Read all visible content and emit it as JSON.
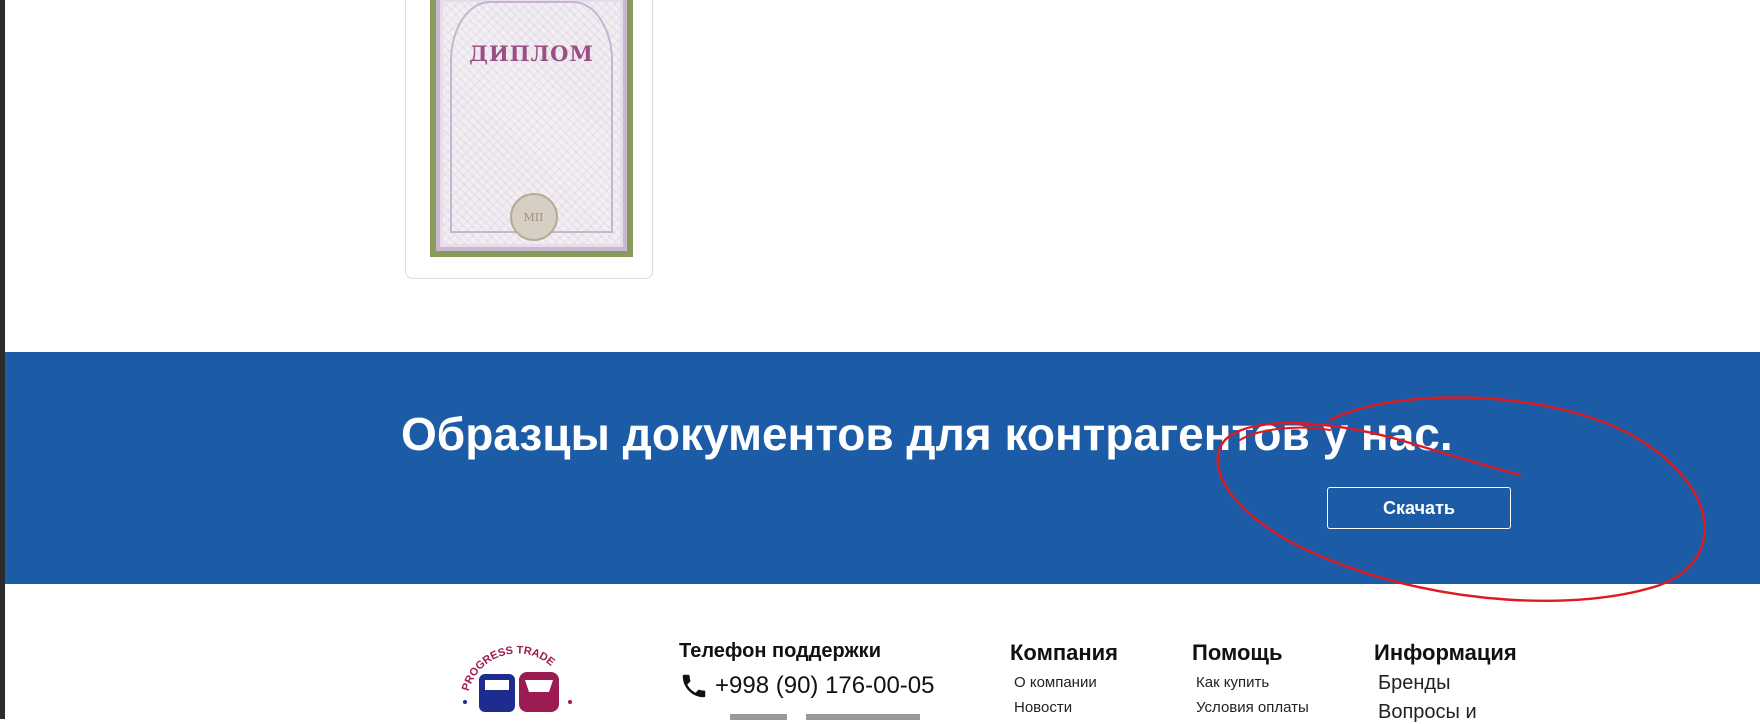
{
  "diploma_card": {
    "title": "ДИПЛОМ",
    "seal_text": "MII"
  },
  "banner": {
    "title": "Образцы документов для контрагентов у нас.",
    "download_label": "Скачать",
    "background_color": "#1c5ca6",
    "annotation_color": "#e0191e"
  },
  "logo": {
    "brand_text": "PROGRESS TRADE",
    "primary_color": "#1f2c8f",
    "secondary_color": "#9b1b52"
  },
  "footer": {
    "support": {
      "heading": "Телефон поддержки",
      "phone": "+998 (90) 176-00-05"
    },
    "company": {
      "heading": "Компания",
      "links": [
        "О компании",
        "Новости"
      ]
    },
    "help": {
      "heading": "Помощь",
      "links": [
        "Как купить",
        "Условия оплаты"
      ]
    },
    "info": {
      "heading": "Информация",
      "links": [
        "Бренды",
        "Вопросы и"
      ]
    }
  }
}
